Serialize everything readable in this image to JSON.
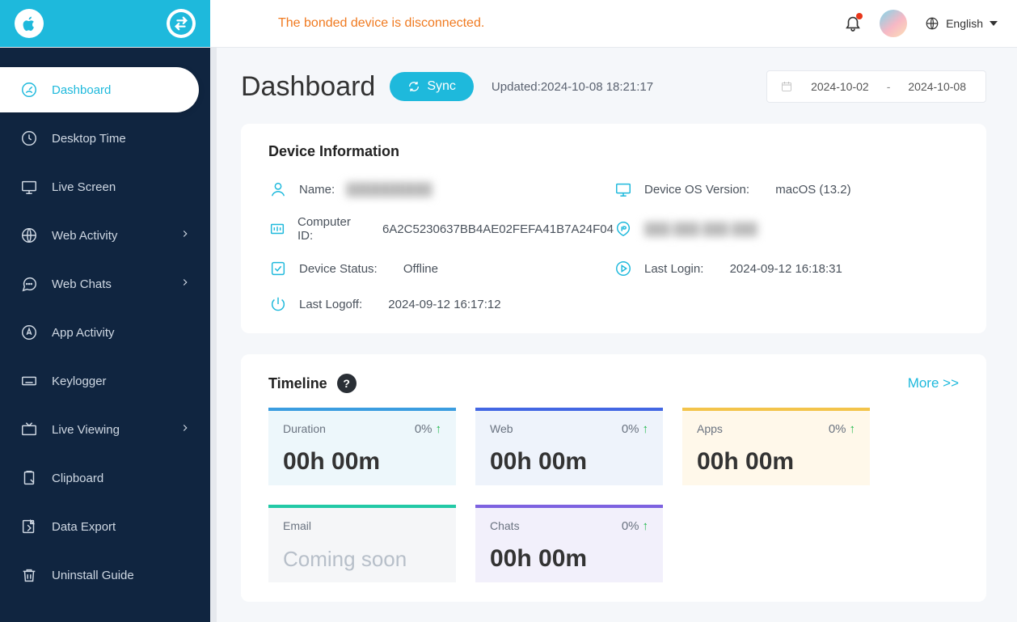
{
  "top": {
    "alert": "The bonded device is disconnected.",
    "language": "English"
  },
  "sidebar": {
    "items": [
      {
        "label": "Dashboard"
      },
      {
        "label": "Desktop Time"
      },
      {
        "label": "Live Screen"
      },
      {
        "label": "Web Activity"
      },
      {
        "label": "Web Chats"
      },
      {
        "label": "App Activity"
      },
      {
        "label": "Keylogger"
      },
      {
        "label": "Live Viewing"
      },
      {
        "label": "Clipboard"
      },
      {
        "label": "Data Export"
      },
      {
        "label": "Uninstall Guide"
      }
    ]
  },
  "page": {
    "title": "Dashboard",
    "sync_label": "Sync",
    "updated_prefix": "Updated:",
    "updated_value": "2024-10-08 18:21:17",
    "date_start": "2024-10-02",
    "date_sep": "-",
    "date_end": "2024-10-08"
  },
  "device_info": {
    "title": "Device Information",
    "name_label": "Name:",
    "name_value": "██████████",
    "os_label": "Device OS Version:",
    "os_value": "macOS (13.2)",
    "id_label": "Computer ID:",
    "id_value": "6A2C5230637BB4AE02FEFA41B7A24F04",
    "ip_value": "███.███.███.███",
    "status_label": "Device Status:",
    "status_value": "Offline",
    "last_login_label": "Last Login:",
    "last_login_value": "2024-09-12 16:18:31",
    "last_logoff_label": "Last Logoff:",
    "last_logoff_value": "2024-09-12 16:17:12"
  },
  "timeline": {
    "title": "Timeline",
    "more_label": "More >>",
    "tiles": {
      "duration": {
        "label": "Duration",
        "pct": "0%",
        "value": "00h 00m"
      },
      "web": {
        "label": "Web",
        "pct": "0%",
        "value": "00h 00m"
      },
      "apps": {
        "label": "Apps",
        "pct": "0%",
        "value": "00h 00m"
      },
      "email": {
        "label": "Email",
        "soon": "Coming soon"
      },
      "chats": {
        "label": "Chats",
        "pct": "0%",
        "value": "00h 00m"
      }
    }
  }
}
